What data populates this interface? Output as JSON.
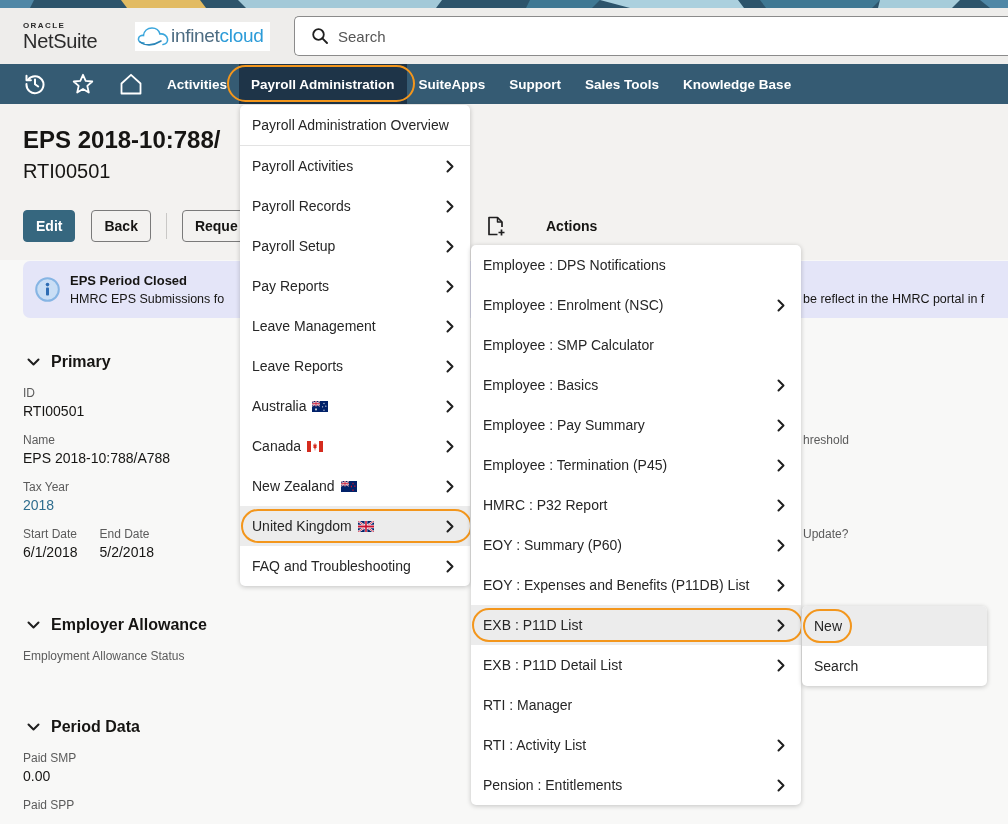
{
  "header": {
    "logo": {
      "caption": "ORACLE",
      "wordmark": "NetSuite"
    },
    "company_logo": [
      "infinet",
      "cloud"
    ],
    "search": {
      "placeholder": "Search"
    }
  },
  "nav": {
    "items": [
      {
        "label": "Activities",
        "selected": false,
        "highlighted": false
      },
      {
        "label": "Payroll Administration",
        "selected": true,
        "highlighted": true
      },
      {
        "label": "SuiteApps",
        "selected": false,
        "highlighted": false
      },
      {
        "label": "Support",
        "selected": false,
        "highlighted": false
      },
      {
        "label": "Sales Tools",
        "selected": false,
        "highlighted": false
      },
      {
        "label": "Knowledge Base",
        "selected": false,
        "highlighted": false
      }
    ]
  },
  "record": {
    "title": "EPS 2018-10:788/",
    "subtitle": "RTI00501",
    "buttons": [
      {
        "label": "Edit",
        "kind": "primary"
      },
      {
        "label": "Back",
        "kind": "secondary"
      },
      {
        "label": "Reque",
        "kind": "secondary"
      }
    ],
    "actions": "Actions"
  },
  "notice": {
    "title": "EPS Period Closed",
    "message": [
      "HMRC EPS Submissions fo",
      "be reflect in the HMRC portal in f"
    ]
  },
  "sections": [
    {
      "title": "Primary",
      "expanded": true,
      "rows": [
        {
          "fields": [
            {
              "label": "ID",
              "value": "RTI00501",
              "kind": "text"
            }
          ]
        },
        {
          "fields": [
            {
              "label": "Name",
              "value": "EPS 2018-10:788/A788",
              "kind": "text"
            }
          ],
          "side_label": "hreshold"
        },
        {
          "fields": [
            {
              "label": "Tax Year",
              "value": "2018",
              "kind": "link"
            }
          ]
        },
        {
          "fields": [
            {
              "label": "Start Date",
              "value": "6/1/2018",
              "kind": "text"
            },
            {
              "label": "End Date",
              "value": "5/2/2018",
              "kind": "text"
            }
          ],
          "side_label": "Update?"
        }
      ]
    },
    {
      "title": "Employer Allowance",
      "expanded": true,
      "rows": [
        {
          "fields": [
            {
              "label": "Employment Allowance Status",
              "kind": "text"
            }
          ]
        }
      ]
    },
    {
      "title": "Period Data",
      "expanded": true,
      "rows": [
        {
          "fields": [
            {
              "label": "Paid SMP",
              "value": "0.00",
              "kind": "text"
            }
          ]
        },
        {
          "fields": [
            {
              "label": "Paid SPP",
              "kind": "text"
            }
          ]
        }
      ]
    }
  ],
  "menus": [
    {
      "groups": [
        {
          "items": [
            {
              "label": "Payroll Administration Overview",
              "kind": "text",
              "has_submenu": false,
              "selected": false,
              "highlighted": false
            }
          ]
        },
        {
          "items": [
            {
              "label": "Payroll Activities",
              "kind": "text",
              "has_submenu": true,
              "selected": false,
              "highlighted": false
            },
            {
              "label": "Payroll Records",
              "kind": "text",
              "has_submenu": true,
              "selected": false,
              "highlighted": false
            },
            {
              "label": "Payroll Setup",
              "kind": "text",
              "has_submenu": true,
              "selected": false,
              "highlighted": false
            },
            {
              "label": "Pay Reports",
              "kind": "text",
              "has_submenu": true,
              "selected": false,
              "highlighted": false
            },
            {
              "label": "Leave Management",
              "kind": "text",
              "has_submenu": true,
              "selected": false,
              "highlighted": false
            },
            {
              "label": "Leave Reports",
              "kind": "text",
              "has_submenu": true,
              "selected": false,
              "highlighted": false
            },
            {
              "label": "Australia",
              "kind": "au",
              "has_submenu": true,
              "selected": false,
              "highlighted": false
            },
            {
              "label": "Canada",
              "kind": "ca",
              "has_submenu": true,
              "selected": false,
              "highlighted": false
            },
            {
              "label": "New Zealand",
              "kind": "nz",
              "has_submenu": true,
              "selected": false,
              "highlighted": false
            },
            {
              "label": "United Kingdom",
              "kind": "gb",
              "has_submenu": true,
              "selected": true,
              "highlighted": true
            },
            {
              "label": "FAQ and Troubleshooting",
              "kind": "text",
              "has_submenu": true,
              "selected": false,
              "highlighted": false
            }
          ]
        }
      ]
    },
    {
      "groups": [
        {
          "items": [
            {
              "label": "Employee : DPS Notifications",
              "kind": "text",
              "has_submenu": false,
              "selected": false,
              "highlighted": false
            },
            {
              "label": "Employee : Enrolment (NSC)",
              "kind": "text",
              "has_submenu": true,
              "selected": false,
              "highlighted": false
            },
            {
              "label": "Employee : SMP Calculator",
              "kind": "text",
              "has_submenu": false,
              "selected": false,
              "highlighted": false
            },
            {
              "label": "Employee : Basics",
              "kind": "text",
              "has_submenu": true,
              "selected": false,
              "highlighted": false
            },
            {
              "label": "Employee : Pay Summary",
              "kind": "text",
              "has_submenu": true,
              "selected": false,
              "highlighted": false
            },
            {
              "label": "Employee : Termination (P45)",
              "kind": "text",
              "has_submenu": true,
              "selected": false,
              "highlighted": false
            },
            {
              "label": "HMRC : P32 Report",
              "kind": "text",
              "has_submenu": true,
              "selected": false,
              "highlighted": false
            },
            {
              "label": "EOY : Summary (P60)",
              "kind": "text",
              "has_submenu": true,
              "selected": false,
              "highlighted": false
            },
            {
              "label": "EOY : Expenses and Benefits (P11DB) List",
              "kind": "text",
              "has_submenu": true,
              "selected": false,
              "highlighted": false
            },
            {
              "label": "EXB : P11D List",
              "kind": "text",
              "has_submenu": true,
              "selected": true,
              "highlighted": true
            },
            {
              "label": "EXB : P11D Detail List",
              "kind": "text",
              "has_submenu": true,
              "selected": false,
              "highlighted": false
            },
            {
              "label": "RTI : Manager",
              "kind": "text",
              "has_submenu": false,
              "selected": false,
              "highlighted": false
            },
            {
              "label": "RTI : Activity List",
              "kind": "text",
              "has_submenu": true,
              "selected": false,
              "highlighted": false
            },
            {
              "label": "Pension : Entitlements",
              "kind": "text",
              "has_submenu": true,
              "selected": false,
              "highlighted": false
            }
          ]
        }
      ]
    },
    {
      "groups": [
        {
          "items": [
            {
              "label": "New",
              "kind": "text",
              "has_submenu": false,
              "selected": true,
              "highlighted": true
            },
            {
              "label": "Search",
              "kind": "text",
              "has_submenu": false,
              "selected": false,
              "highlighted": false
            }
          ]
        }
      ]
    }
  ]
}
